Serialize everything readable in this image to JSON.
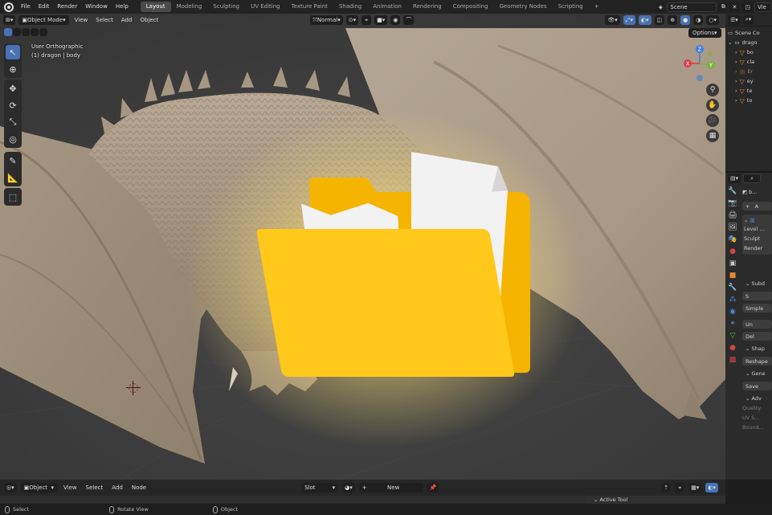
{
  "topbar": {
    "menus": [
      "File",
      "Edit",
      "Render",
      "Window",
      "Help"
    ],
    "workspace_tabs": [
      "Layout",
      "Modeling",
      "Sculpting",
      "UV Editing",
      "Texture Paint",
      "Shading",
      "Animation",
      "Rendering",
      "Compositing",
      "Geometry Nodes",
      "Scripting"
    ],
    "active_tab": "Layout",
    "add_tab": "+",
    "scene_label": "Scene",
    "view_layer_label": "Vie"
  },
  "viewport_header": {
    "mode": "Object Mode",
    "menus": [
      "View",
      "Select",
      "Add",
      "Object"
    ],
    "transform_orientation": "Normal",
    "options_label": "Options"
  },
  "viewport_overlay": {
    "view_name": "User Orthographic",
    "object_info": "(1) dragon | body"
  },
  "gizmo": {
    "axes": [
      "Z",
      "X",
      "Y"
    ],
    "axis_colors": {
      "x": "#e0394a",
      "y": "#7ab33e",
      "z": "#3d7de0"
    }
  },
  "outliner": {
    "title": "Scene Co",
    "rows": [
      "drago",
      "bo",
      "cla",
      "Er",
      "ey",
      "te",
      "to"
    ]
  },
  "properties": {
    "object_short": "b...",
    "add_label": "+",
    "modifier_short": "A",
    "rows": [
      "Level ...",
      "Sculpt",
      "Render"
    ],
    "subdivision_panel": "Subd",
    "buttons": [
      "S",
      "Simple",
      "Un",
      "Del"
    ],
    "shape_panel": "Shap",
    "reshape_button": "Reshape",
    "generate_panel": "Gene",
    "save_button": "Save",
    "advanced_panel": "Adv",
    "advanced_rows": [
      "Quality",
      "UV S...",
      "Bound..."
    ]
  },
  "bottom_header": {
    "editor_mode": "Object",
    "menus": [
      "View",
      "Select",
      "Add",
      "Node"
    ],
    "slot": "Slot",
    "new_button": "New",
    "active_tool_panel": "Active Tool"
  },
  "statusbar": {
    "items": [
      "Select",
      "Rotate View",
      "Object"
    ]
  },
  "folder_overlay": {
    "folder_color": "#ffc81a",
    "folder_back_color": "#f5b400",
    "paper_color": "#f2f2f2",
    "glow_color": "#ffe27a"
  }
}
